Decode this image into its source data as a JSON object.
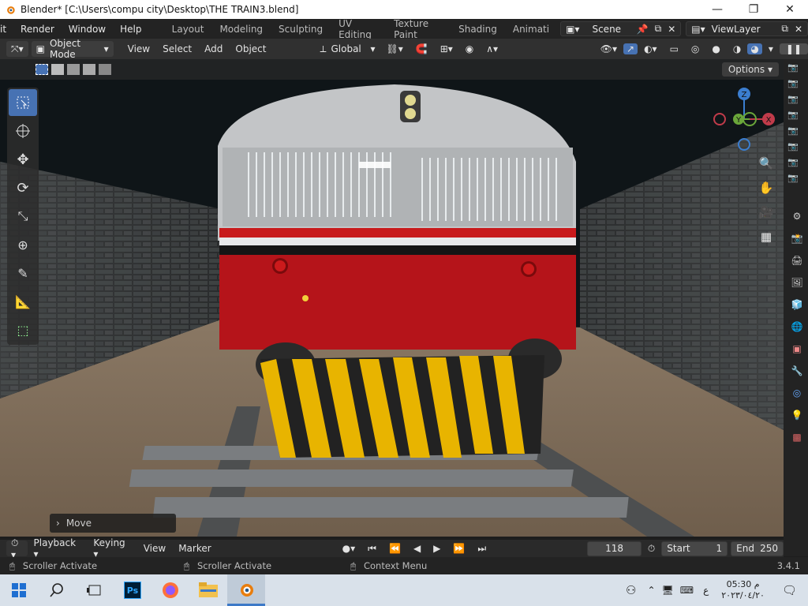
{
  "window": {
    "title": "Blender* [C:\\Users\\compu city\\Desktop\\THE TRAIN3.blend]",
    "minimize": "—",
    "maximize": "❐",
    "close": "✕"
  },
  "menubar": {
    "items": [
      "it",
      "Render",
      "Window",
      "Help"
    ],
    "workspaces": [
      "Layout",
      "Modeling",
      "Sculpting",
      "UV Editing",
      "Texture Paint",
      "Shading",
      "Animati"
    ],
    "scene": "Scene",
    "view_layer": "ViewLayer"
  },
  "header": {
    "mode": "Object Mode",
    "menus": [
      "View",
      "Select",
      "Add",
      "Object"
    ],
    "orientation": "Global"
  },
  "viewport": {
    "options_label": "Options",
    "last_op_label": "Move",
    "gizmo": {
      "z": "Z",
      "y": "Y",
      "x": "X"
    }
  },
  "timeline": {
    "menus": [
      "Playback",
      "Keying",
      "View",
      "Marker"
    ],
    "current_frame": "118",
    "start_label": "Start",
    "start": "1",
    "end_label": "End",
    "end": "250"
  },
  "statusbar": {
    "left": "Scroller Activate",
    "middle": "Scroller Activate",
    "right": "Context Menu",
    "version": "3.4.1"
  },
  "taskbar": {
    "time": "05:30 م",
    "date": "٢٠٢٣/٠٤/٢٠",
    "lang": "ع"
  },
  "colors": {
    "accent": "#4772b3",
    "train_red": "#b5141a",
    "stripe_yellow": "#e8b400"
  }
}
